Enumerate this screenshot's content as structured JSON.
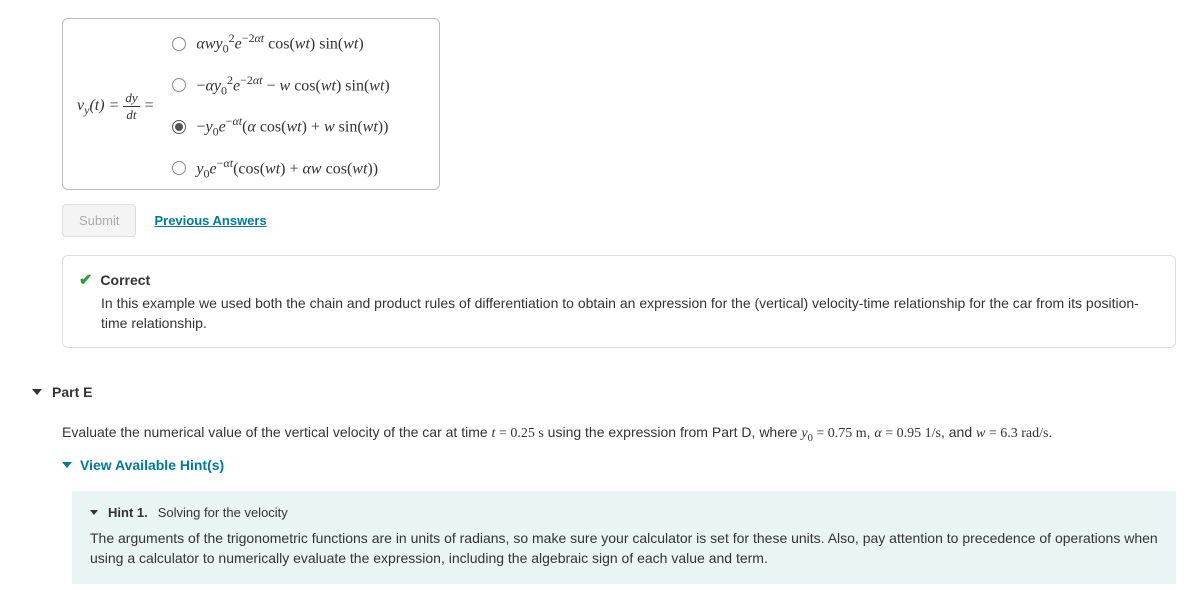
{
  "mc": {
    "prompt_html": "<i>v<sub>y</sub></i>(<i>t</i>) = <span style='display:inline-block;vertical-align:middle;font-size:13px'><span style='display:block;border-bottom:1px solid #333;padding:0 2px'><i>dy</i></span><span style='display:block;text-align:center'><i>dt</i></span></span> =",
    "options": [
      {
        "selected": false,
        "html": "<i>αwy</i><sub>0</sub><sup>2</sup><i>e</i><sup>−2<i>αt</i></sup> cos(<i>wt</i>) sin(<i>wt</i>)"
      },
      {
        "selected": false,
        "html": "−<i>αy</i><sub>0</sub><sup>2</sup><i>e</i><sup>−2<i>αt</i></sup> − <i>w</i> cos(<i>wt</i>) sin(<i>wt</i>)"
      },
      {
        "selected": true,
        "html": "−<i>y</i><sub>0</sub><i>e</i><sup>−<i>αt</i></sup>(<i>α</i> cos(<i>wt</i>) + <i>w</i> sin(<i>wt</i>))"
      },
      {
        "selected": false,
        "html": "<i>y</i><sub>0</sub><i>e</i><sup>−<i>αt</i></sup>(cos(<i>wt</i>) + <i>αw</i> cos(<i>wt</i>))"
      }
    ]
  },
  "submit_label": "Submit",
  "prev_answers_label": "Previous Answers",
  "feedback": {
    "title": "Correct",
    "body": "In this example we used both the chain and product rules of differentiation to obtain an expression for the (vertical) velocity-time relationship for the car from its position-time relationship."
  },
  "partE": {
    "label": "Part E",
    "instruction_html": "Evaluate the numerical value of the vertical velocity of the car at time <span class='serif'><i>t</i> = 0.25 s</span> using the expression from Part D, where <span class='serif'><i>y</i><sub>0</sub> = 0.75 m</span>, <span class='serif'><i>α</i> = 0.95 1/s</span>, and <span class='serif'><i>w</i> = 6.3 rad/s</span>.",
    "hints_toggle": "View Available Hint(s)",
    "hint": {
      "num": "Hint 1.",
      "title": "Solving for the velocity",
      "body": "The arguments of the trigonometric functions are in units of radians, so make sure your calculator is set for these units. Also, pay attention to precedence of operations when using a calculator to numerically evaluate the expression, including the algebraic sign of each value and term."
    }
  }
}
